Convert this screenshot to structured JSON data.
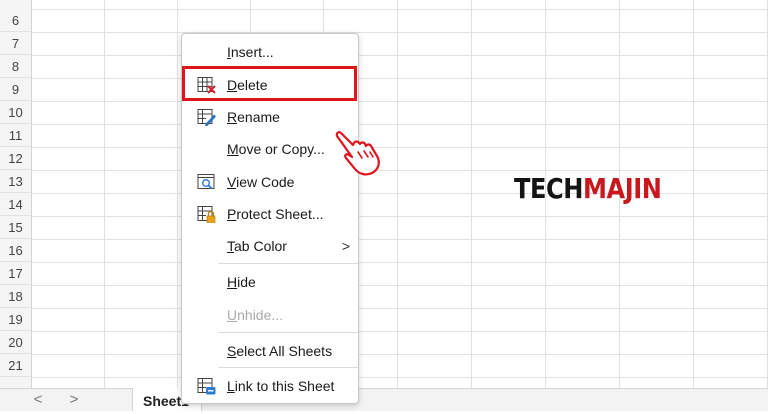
{
  "row_numbers": [
    "6",
    "7",
    "8",
    "9",
    "10",
    "11",
    "12",
    "13",
    "14",
    "15",
    "16",
    "17",
    "18",
    "19",
    "20",
    "21"
  ],
  "sheet_tab": {
    "label": "Sheet1"
  },
  "nav": {
    "prev": "<",
    "next": ">",
    "add": "+"
  },
  "logo": {
    "part1": "TECH",
    "part2": "MAJIN"
  },
  "context_menu": {
    "items": [
      {
        "key": "I",
        "rest": "nsert...",
        "icon": null,
        "enabled": true
      },
      {
        "key": "D",
        "rest": "elete",
        "icon": "delete-sheet-icon",
        "enabled": true,
        "highlighted": true
      },
      {
        "key": "R",
        "rest": "ename",
        "icon": "rename-sheet-icon",
        "enabled": true
      },
      {
        "key": "M",
        "rest": "ove or Copy...",
        "icon": null,
        "enabled": true
      },
      {
        "key": "V",
        "rest": "iew Code",
        "icon": "view-code-icon",
        "enabled": true
      },
      {
        "key": "P",
        "rest": "rotect Sheet...",
        "icon": "protect-sheet-icon",
        "enabled": true
      },
      {
        "key": "T",
        "rest": "ab Color",
        "icon": null,
        "enabled": true,
        "submenu": true
      },
      {
        "key": "H",
        "rest": "ide",
        "icon": null,
        "enabled": true
      },
      {
        "key": "U",
        "rest": "nhide...",
        "icon": null,
        "enabled": false
      },
      {
        "key": "S",
        "rest": "elect All Sheets",
        "icon": null,
        "enabled": true
      },
      {
        "key": "L",
        "rest": "ink to this Sheet",
        "icon": "link-sheet-icon",
        "enabled": true
      }
    ],
    "submenu_arrow": ">"
  },
  "colors": {
    "highlight": "#e0141c",
    "logo_dark": "#141414",
    "logo_red": "#c8181e"
  }
}
